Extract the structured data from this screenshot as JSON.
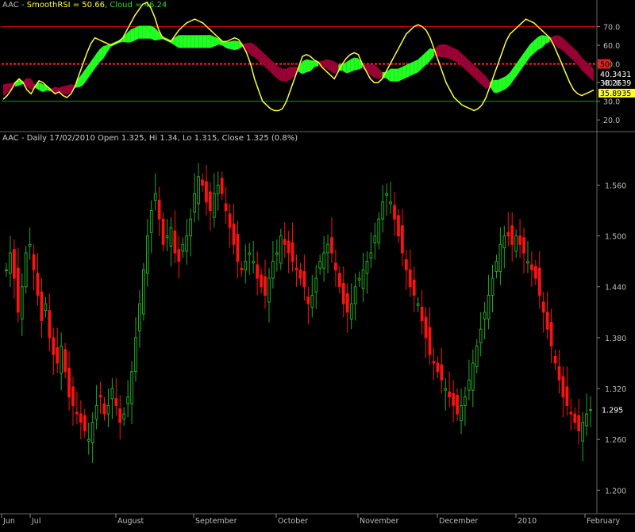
{
  "indicator_panel": {
    "title_prefix": "AAC - ",
    "smooth_label": "SmoothRSI = 50.66",
    "separator": ", ",
    "cloud_label": "Cloud = 46.24"
  },
  "price_panel": {
    "title": "AAC - Daily 17/02/2010 Open 1.325, Hi 1.34, Lo 1.315, Close 1.325 (0.8%)"
  },
  "colors": {
    "background": "#000000",
    "rsi_line": "#ffff33",
    "cloud_up": "#22ff22",
    "cloud_down": "#990033",
    "candle_up": "#22aa22",
    "candle_down": "#ff1111",
    "ref_line_70": "#cc0000",
    "ref_line_30": "#00aa00",
    "ref_line_50": "#ff2222",
    "grid": "#444444"
  },
  "chart_data": [
    {
      "type": "line",
      "title": "AAC - SmoothRSI = 50.66, Cloud = 46.24",
      "ylim": [
        15,
        80
      ],
      "y_ticks": [
        "70.0",
        "60.0",
        "50.0",
        "40.0",
        "30.0",
        "20.0"
      ],
      "reference_lines": [
        70,
        50,
        30
      ],
      "reference_label": "50",
      "last_value_labels": [
        "40.3431",
        "38.2639",
        "35.8935"
      ],
      "series": [
        {
          "name": "SmoothRSI",
          "values": [
            31,
            33,
            36,
            40,
            42,
            40,
            36,
            34,
            38,
            41,
            40,
            38,
            36,
            34,
            35,
            33,
            32,
            34,
            38,
            44,
            50,
            56,
            61,
            64,
            63,
            62,
            61,
            60,
            61,
            62,
            64,
            68,
            72,
            76,
            79,
            82,
            83,
            80,
            75,
            68,
            64,
            63,
            62,
            65,
            68,
            70,
            72,
            73,
            74,
            73,
            72,
            70,
            68,
            66,
            64,
            62,
            62,
            63,
            64,
            63,
            60,
            56,
            50,
            42,
            36,
            30,
            28,
            26,
            25,
            25,
            26,
            30,
            36,
            42,
            48,
            54,
            55,
            54,
            52,
            51,
            48,
            46,
            44,
            42,
            46,
            50,
            53,
            55,
            56,
            55,
            50,
            46,
            42,
            40,
            40,
            42,
            46,
            50,
            54,
            58,
            62,
            66,
            68,
            70,
            71,
            70,
            68,
            64,
            58,
            52,
            46,
            40,
            36,
            32,
            30,
            28,
            27,
            26,
            25,
            26,
            28,
            32,
            38,
            44,
            50,
            56,
            62,
            66,
            68,
            70,
            72,
            74,
            73,
            72,
            70,
            68,
            66,
            64,
            60,
            55,
            50,
            45,
            40,
            36,
            34,
            33,
            34,
            35,
            36
          ],
          "note_color": "#ffff33"
        },
        {
          "name": "Cloud",
          "values": [
            36,
            37,
            38,
            39,
            40,
            40,
            40,
            39,
            38,
            38,
            37,
            37,
            36,
            36,
            36,
            36,
            36,
            37,
            38,
            40,
            42,
            45,
            48,
            51,
            54,
            56,
            58,
            60,
            61,
            62,
            63,
            64,
            65,
            66,
            67,
            67,
            67,
            67,
            66,
            65,
            64,
            63,
            62,
            62,
            62,
            62,
            62,
            62,
            62,
            62,
            62,
            62,
            62,
            62,
            62,
            61,
            60,
            60,
            60,
            60,
            60,
            59,
            58,
            57,
            55,
            53,
            51,
            49,
            47,
            45,
            44,
            44,
            45,
            46,
            47,
            48,
            49,
            49,
            50,
            50,
            50,
            50,
            49,
            48,
            48,
            48,
            48,
            49,
            50,
            50,
            49,
            48,
            47,
            46,
            45,
            44,
            44,
            44,
            44,
            44,
            45,
            46,
            47,
            48,
            49,
            51,
            53,
            55,
            56,
            57,
            57,
            57,
            56,
            55,
            54,
            52,
            50,
            48,
            46,
            44,
            42,
            40,
            39,
            38,
            38,
            39,
            40,
            42,
            45,
            48,
            51,
            54,
            57,
            59,
            61,
            62,
            63,
            63,
            63,
            62,
            61,
            59,
            57,
            55,
            53,
            50,
            48,
            46,
            44,
            43,
            42,
            42,
            41,
            40
          ]
        }
      ]
    },
    {
      "type": "candlestick",
      "title": "AAC - Daily 17/02/2010 Open 1.325, Hi 1.34, Lo 1.315, Close 1.325 (0.8%)",
      "ylim": [
        1.175,
        1.61
      ],
      "y_ticks": [
        "1.560",
        "1.500",
        "1.440",
        "1.380",
        "1.320",
        "1.260",
        "1.200"
      ],
      "last_price_label": "1.295",
      "x_ticks": [
        "Jun",
        "Jul",
        "August",
        "September",
        "October",
        "November",
        "December",
        "2010",
        "February"
      ],
      "close": [
        1.46,
        1.48,
        1.45,
        1.41,
        1.44,
        1.48,
        1.49,
        1.46,
        1.43,
        1.4,
        1.42,
        1.38,
        1.36,
        1.35,
        1.37,
        1.34,
        1.31,
        1.3,
        1.29,
        1.28,
        1.27,
        1.26,
        1.28,
        1.3,
        1.31,
        1.29,
        1.3,
        1.32,
        1.3,
        1.28,
        1.29,
        1.31,
        1.34,
        1.38,
        1.42,
        1.46,
        1.5,
        1.53,
        1.55,
        1.52,
        1.49,
        1.5,
        1.51,
        1.48,
        1.47,
        1.49,
        1.5,
        1.52,
        1.55,
        1.57,
        1.56,
        1.54,
        1.53,
        1.55,
        1.56,
        1.55,
        1.53,
        1.51,
        1.49,
        1.47,
        1.46,
        1.47,
        1.48,
        1.47,
        1.45,
        1.44,
        1.43,
        1.45,
        1.47,
        1.48,
        1.5,
        1.49,
        1.48,
        1.47,
        1.46,
        1.45,
        1.44,
        1.42,
        1.43,
        1.45,
        1.47,
        1.48,
        1.49,
        1.48,
        1.46,
        1.44,
        1.42,
        1.41,
        1.42,
        1.44,
        1.45,
        1.46,
        1.47,
        1.48,
        1.5,
        1.52,
        1.54,
        1.55,
        1.54,
        1.52,
        1.5,
        1.48,
        1.46,
        1.44,
        1.43,
        1.42,
        1.4,
        1.38,
        1.36,
        1.35,
        1.34,
        1.33,
        1.32,
        1.31,
        1.3,
        1.29,
        1.3,
        1.31,
        1.33,
        1.35,
        1.37,
        1.39,
        1.41,
        1.43,
        1.45,
        1.47,
        1.49,
        1.5,
        1.5,
        1.49,
        1.5,
        1.49,
        1.48,
        1.47,
        1.46,
        1.45,
        1.43,
        1.41,
        1.39,
        1.37,
        1.35,
        1.33,
        1.31,
        1.3,
        1.29,
        1.28,
        1.27,
        1.28,
        1.29,
        1.295
      ]
    }
  ]
}
